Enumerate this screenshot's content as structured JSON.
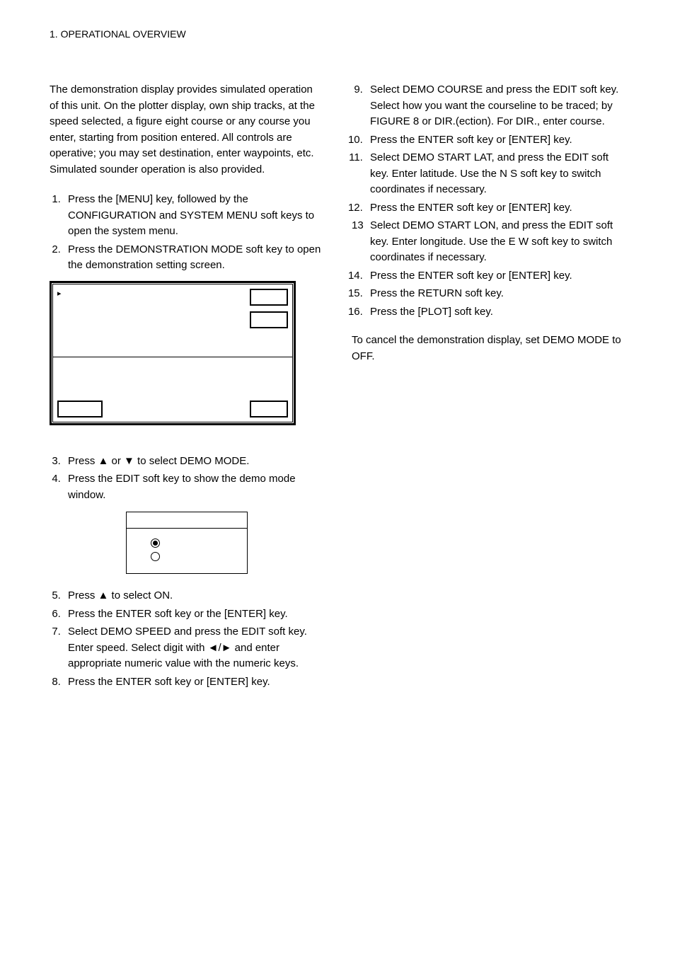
{
  "header": "1. OPERATIONAL OVERVIEW",
  "intro": "The demonstration display provides simulated operation of this unit. On the plotter display, own ship tracks, at the speed selected, a figure eight course or any course you enter, starting from position entered. All controls are operative; you may set destination, enter waypoints, etc. Simulated sounder operation is also provided.",
  "left": {
    "step1": "Press the [MENU] key, followed by the CONFIGURATION and SYSTEM MENU soft keys to open the system menu.",
    "step2": "Press the DEMONSTRATION MODE soft key to open the demonstration setting screen.",
    "step3": "Press ▲ or ▼ to select DEMO MODE.",
    "step4": "Press the EDIT soft key to show the demo mode window.",
    "step5": "Press ▲ to select ON.",
    "step6": "Press the ENTER soft key or the [ENTER] key.",
    "step7": "Select DEMO SPEED and press the EDIT soft key. Enter speed. Select digit with ◄/► and enter appropriate numeric value with the numeric keys.",
    "step8": "Press the ENTER soft key or [ENTER] key."
  },
  "right": {
    "step9": "Select DEMO COURSE and press the EDIT soft key. Select how you want the courseline to be traced; by FIGURE 8 or DIR.(ection). For DIR., enter course.",
    "step10": "Press the ENTER soft key or [ENTER] key.",
    "step11": "Select DEMO START LAT, and press the EDIT soft key. Enter latitude. Use the N       S soft key to switch coordinates if necessary.",
    "step12": "Press the ENTER soft key or [ENTER] key.",
    "step13": "Select DEMO START LON, and press the EDIT soft key. Enter longitude. Use the E       W soft key to switch coordinates if necessary.",
    "step14": "Press the ENTER soft key or [ENTER] key.",
    "step15": "Press the RETURN soft key.",
    "step16": "Press the [PLOT] soft key."
  },
  "closing": "To cancel the demonstration display, set DEMO MODE to OFF.",
  "triangle": "▸"
}
